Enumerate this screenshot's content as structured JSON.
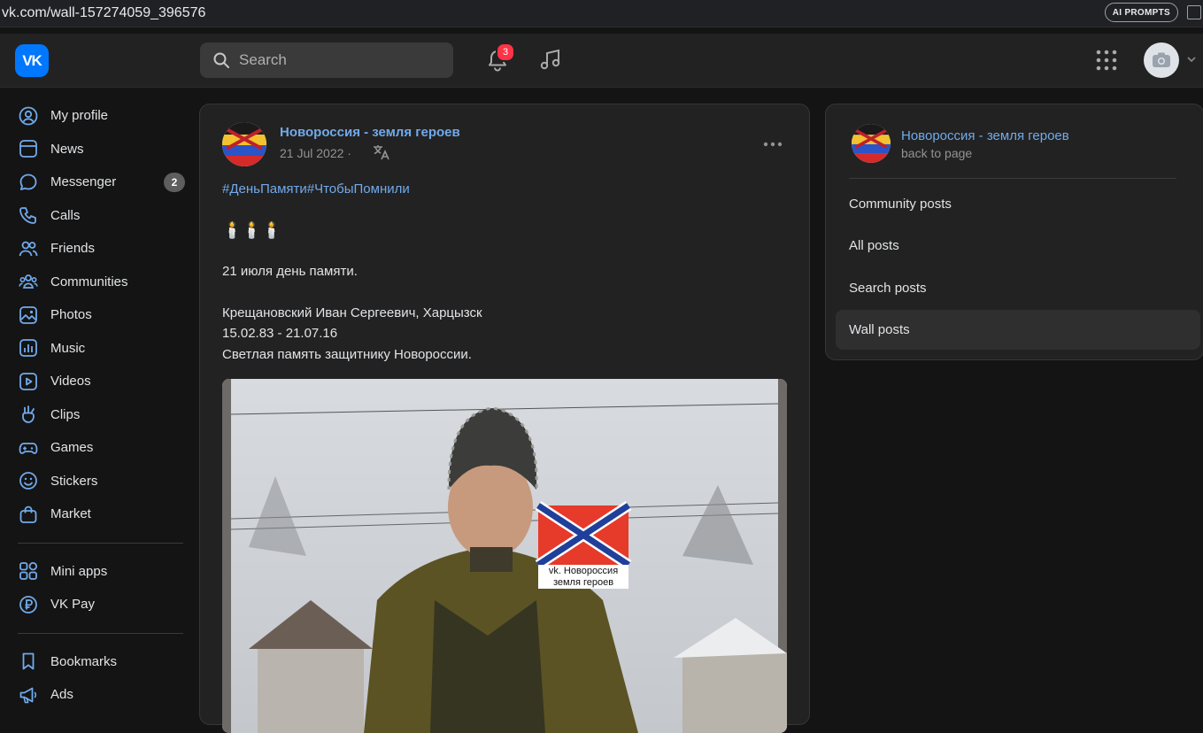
{
  "browser": {
    "url": "vk.com/wall-157274059_396576",
    "ai_prompts_label": "AI PROMPTS"
  },
  "header": {
    "logo_text": "VK",
    "search_placeholder": "Search",
    "notifications_count": "3"
  },
  "sidebar": {
    "items": [
      {
        "label": "My profile",
        "icon": "profile-icon"
      },
      {
        "label": "News",
        "icon": "news-icon"
      },
      {
        "label": "Messenger",
        "icon": "messenger-icon",
        "badge": "2"
      },
      {
        "label": "Calls",
        "icon": "phone-icon"
      },
      {
        "label": "Friends",
        "icon": "friends-icon"
      },
      {
        "label": "Communities",
        "icon": "communities-icon"
      },
      {
        "label": "Photos",
        "icon": "photos-icon"
      },
      {
        "label": "Music",
        "icon": "music-icon"
      },
      {
        "label": "Videos",
        "icon": "videos-icon"
      },
      {
        "label": "Clips",
        "icon": "clips-icon"
      },
      {
        "label": "Games",
        "icon": "games-icon"
      },
      {
        "label": "Stickers",
        "icon": "stickers-icon"
      },
      {
        "label": "Market",
        "icon": "market-icon"
      }
    ],
    "items2": [
      {
        "label": "Mini apps",
        "icon": "mini-apps-icon"
      },
      {
        "label": "VK Pay",
        "icon": "vk-pay-icon"
      }
    ],
    "items3": [
      {
        "label": "Bookmarks",
        "icon": "bookmark-icon"
      },
      {
        "label": "Ads",
        "icon": "ads-icon"
      }
    ]
  },
  "post": {
    "author": "Новороссия - земля героев",
    "date": "21 Jul 2022",
    "date_sep": "·",
    "hashtags": "#ДеньПамяти#ЧтобыПомнили",
    "candles": "🕯️🕯️🕯️",
    "line1": "21 июля день памяти.",
    "line2": "Крещановский Иван Сергеевич, Харцызск",
    "line3": "15.02.83 - 21.07.16",
    "line4": "Светлая память защитнику Новороссии.",
    "photo_caption_1": "vk. Новороссия",
    "photo_caption_2": "земля героев"
  },
  "right_panel": {
    "community_name": "Новороссия - земля героев",
    "back_label": "back to page",
    "menu": [
      {
        "label": "Community posts",
        "active": false
      },
      {
        "label": "All posts",
        "active": false
      },
      {
        "label": "Search posts",
        "active": false
      },
      {
        "label": "Wall posts",
        "active": true
      }
    ]
  },
  "colors": {
    "accent": "#0077ff",
    "link": "#71aaeb",
    "badge_red": "#ff3347",
    "background": "#141414",
    "card": "#222222"
  }
}
